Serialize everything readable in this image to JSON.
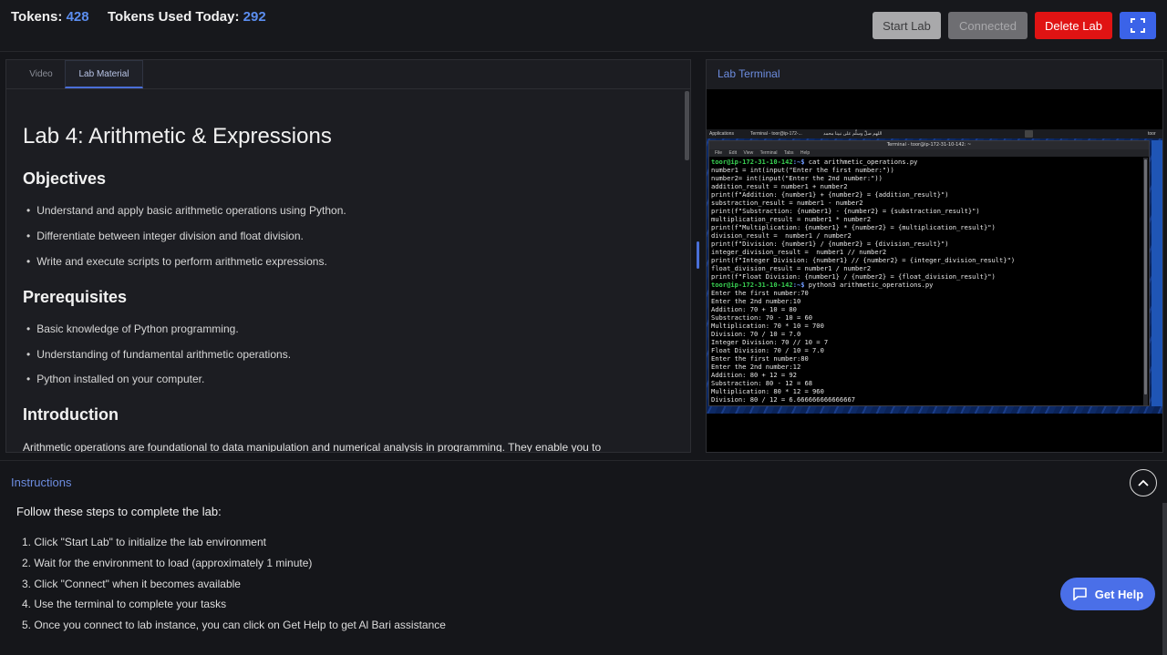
{
  "header": {
    "tokens_label": "Tokens:",
    "tokens_value": "428",
    "tokens_used_label": "Tokens Used Today:",
    "tokens_used_value": "292",
    "start_label": "Start Lab",
    "connected_label": "Connected",
    "delete_label": "Delete Lab",
    "fullscreen_icon": "fullscreen-icon"
  },
  "tabs": [
    {
      "label": "Video"
    },
    {
      "label": "Lab Material"
    }
  ],
  "lab": {
    "title": "Lab 4: Arithmetic & Expressions",
    "objectives_heading": "Objectives",
    "objectives": [
      "Understand and apply basic arithmetic operations using Python.",
      "Differentiate between integer division and float division.",
      "Write and execute scripts to perform arithmetic expressions."
    ],
    "prereq_heading": "Prerequisites",
    "prerequisites": [
      "Basic knowledge of Python programming.",
      "Understanding of fundamental arithmetic operations.",
      "Python installed on your computer."
    ],
    "intro_heading": "Introduction",
    "intro_text": "Arithmetic operations are foundational to data manipulation and numerical analysis in programming. They enable you to"
  },
  "terminal": {
    "panel_title": "Lab Terminal",
    "taskbar_apps": "Applications",
    "taskbar_window": "Terminal - toor@ip-172-...",
    "taskbar_arabic": "اللهم صلِّ وسلِّم على نبينا محمد",
    "taskbar_user": "toor",
    "window_title": "Terminal - toor@ip-172-31-10-142: ~",
    "menu": [
      "File",
      "Edit",
      "View",
      "Terminal",
      "Tabs",
      "Help"
    ],
    "prompt_user": "toor@ip-172-31-10-142",
    "prompt_dir": ":~$ ",
    "cmd1": "cat arithmetic_operations.py",
    "cmd2": "python3 arithmetic_operations.py",
    "code_lines": [
      "number1 = int(input(\"Enter the first number:\"))",
      "number2= int(input(\"Enter the 2nd number:\"))",
      "addition_result = number1 + number2",
      "print(f\"Addition: {number1} + {number2} = {addition_result}\")",
      "substraction_result = number1 - number2",
      "print(f\"Substraction: {number1} - {number2} = {substraction_result}\")",
      "multiplication_result = number1 * number2",
      "print(f\"Multiplication: {number1} * {number2} = {multiplication_result}\")",
      "division_result =  number1 / number2",
      "print(f\"Division: {number1} / {number2} = {division_result}\")",
      "integer_division_result =  number1 // number2",
      "print(f\"Integer Division: {number1} // {number2} = {integer_division_result}\")",
      "float_division_result = number1 / number2",
      "print(f\"Float Division: {number1} / {number2} = {float_division_result}\")"
    ],
    "output_lines": [
      "Enter the first number:70",
      "Enter the 2nd number:10",
      "Addition: 70 + 10 = 80",
      "Substraction: 70 - 10 = 60",
      "Multiplication: 70 * 10 = 700",
      "Division: 70 / 10 = 7.0",
      "Integer Division: 70 // 10 = 7",
      "Float Division: 70 / 10 = 7.0",
      "Enter the first number:80",
      "Enter the 2nd number:12",
      "Addition: 80 + 12 = 92",
      "Substraction: 80 - 12 = 68",
      "Multiplication: 80 * 12 = 960",
      "Division: 80 / 12 = 6.666666666666667"
    ]
  },
  "instructions": {
    "title": "Instructions",
    "intro": "Follow these steps to complete the lab:",
    "steps": [
      "1. Click \"Start Lab\" to initialize the lab environment",
      "2. Wait for the environment to load (approximately 1 minute)",
      "3. Click \"Connect\" when it becomes available",
      "4. Use the terminal to complete your tasks",
      "5. Once you connect to lab instance, you can click on Get Help to get Al Bari assistance"
    ]
  },
  "help": {
    "label": "Get Help",
    "icon": "chat-icon"
  },
  "colors": {
    "accent": "#4a6fe8",
    "danger": "#e01313",
    "prompt_green": "#39d353"
  }
}
